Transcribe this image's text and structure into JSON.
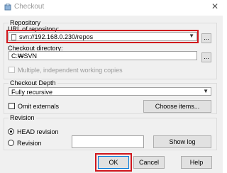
{
  "window": {
    "title": "Checkout",
    "close_glyph": "✕"
  },
  "repository": {
    "group_title": "Repository",
    "url_label": "URL of repository:",
    "url_value": "svn://192.168.0.230/repos",
    "checkout_dir_label": "Checkout directory:",
    "checkout_dir_value": "C:₩SVN",
    "browse_label": "...",
    "multiple_label": "Multiple, independent working copies"
  },
  "depth": {
    "group_title": "Checkout Depth",
    "selected": "Fully recursive",
    "omit_externals_label": "Omit externals",
    "choose_items_label": "Choose items..."
  },
  "revision": {
    "group_title": "Revision",
    "head_label": "HEAD revision",
    "revision_label": "Revision",
    "show_log_label": "Show log"
  },
  "buttons": {
    "ok": "OK",
    "cancel": "Cancel",
    "help": "Help"
  },
  "colors": {
    "highlight": "#d0161d",
    "dialog_bg": "#f0f0f0"
  }
}
